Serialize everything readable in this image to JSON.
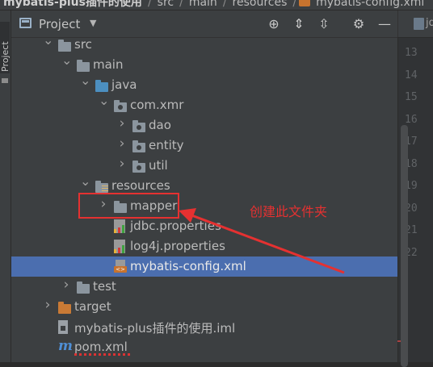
{
  "breadcrumb": [
    {
      "label": "mybatis-plus插件的使用"
    },
    {
      "label": "src"
    },
    {
      "label": "main"
    },
    {
      "label": "resources"
    },
    {
      "label": "mybatis-config.xml"
    }
  ],
  "sidebar": {
    "label": "Project"
  },
  "panel": {
    "title": "Project",
    "dropdown_icon": "▼",
    "toolbar": [
      {
        "name": "locate-icon",
        "glyph": "⊕"
      },
      {
        "name": "expand-all-icon",
        "glyph": "⇕"
      },
      {
        "name": "collapse-all-icon",
        "glyph": "⇳"
      },
      {
        "name": "gear-icon",
        "glyph": "⚙"
      },
      {
        "name": "hide-icon",
        "glyph": "—"
      }
    ]
  },
  "editor_tab": {
    "label": "jd"
  },
  "line_numbers": [
    "13",
    "14",
    "15",
    "16",
    "17",
    "18",
    "19",
    "20",
    "21",
    "22"
  ],
  "tree": [
    {
      "label": "src",
      "depth": 2,
      "expanded": true,
      "icon": "folder"
    },
    {
      "label": "main",
      "depth": 3,
      "expanded": true,
      "icon": "folder"
    },
    {
      "label": "java",
      "depth": 4,
      "expanded": true,
      "icon": "source-folder"
    },
    {
      "label": "com.xmr",
      "depth": 5,
      "expanded": true,
      "icon": "package"
    },
    {
      "label": "dao",
      "depth": 6,
      "expanded": false,
      "icon": "package"
    },
    {
      "label": "entity",
      "depth": 6,
      "expanded": false,
      "icon": "package"
    },
    {
      "label": "util",
      "depth": 6,
      "expanded": false,
      "icon": "package"
    },
    {
      "label": "resources",
      "depth": 4,
      "expanded": true,
      "icon": "resources-folder"
    },
    {
      "label": "mapper",
      "depth": 5,
      "expanded": false,
      "icon": "folder"
    },
    {
      "label": "jdbc.properties",
      "depth": 5,
      "icon": "properties-file"
    },
    {
      "label": "log4j.properties",
      "depth": 5,
      "icon": "properties-file"
    },
    {
      "label": "mybatis-config.xml",
      "depth": 5,
      "icon": "xml-file",
      "selected": true
    },
    {
      "label": "test",
      "depth": 3,
      "expanded": false,
      "icon": "folder"
    },
    {
      "label": "target",
      "depth": 2,
      "expanded": false,
      "icon": "excluded-folder"
    },
    {
      "label": "mybatis-plus插件的使用.iml",
      "depth": 2,
      "icon": "iml-file"
    },
    {
      "label": "pom.xml",
      "depth": 2,
      "icon": "maven-file"
    }
  ],
  "annotation": {
    "text": "创建此文件夹",
    "color": "#e53131"
  }
}
